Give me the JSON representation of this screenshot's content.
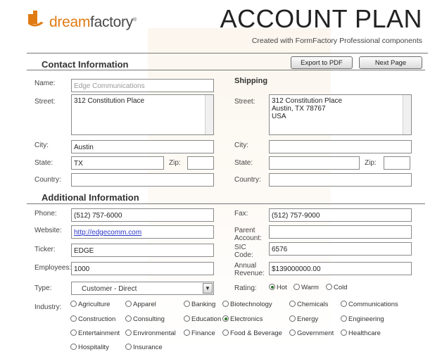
{
  "header": {
    "logo_text_accent": "dream",
    "logo_text_rest": "factory",
    "logo_tm": "®",
    "title": "ACCOUNT PLAN",
    "subtitle": "Created with FormFactory Professional components"
  },
  "toolbar": {
    "export_label": "Export to PDF",
    "next_label": "Next Page"
  },
  "contact": {
    "section_title": "Contact Information",
    "name_label": "Name:",
    "name_value": "Edge Communications",
    "street_label": "Street:",
    "street_value": "312 Constitution Place",
    "city_label": "City:",
    "city_value": "Austin",
    "state_label": "State:",
    "state_value": "TX",
    "zip_label": "Zip:",
    "zip_value": "",
    "country_label": "Country:",
    "country_value": ""
  },
  "shipping": {
    "section_title": "Shipping",
    "street_label": "Street:",
    "street_line1": "312 Constitution Place",
    "street_line2": "Austin, TX 78767",
    "street_line3": "USA",
    "city_label": "City:",
    "city_value": "",
    "state_label": "State:",
    "state_value": "",
    "zip_label": "Zip:",
    "zip_value": "",
    "country_label": "Country:",
    "country_value": ""
  },
  "additional": {
    "section_title": "Additional Information",
    "phone_label": "Phone:",
    "phone_value": "(512) 757-6000",
    "fax_label": "Fax:",
    "fax_value": "(512) 757-9000",
    "website_label": "Website:",
    "website_value": "http://edgecomm.com",
    "parent_label_1": "Parent",
    "parent_label_2": "Account:",
    "parent_value": "",
    "ticker_label": "Ticker:",
    "ticker_value": "EDGE",
    "sic_label_1": "SIC",
    "sic_label_2": "Code:",
    "sic_value": "6576",
    "employees_label": "Employees:",
    "employees_value": "1000",
    "revenue_label_1": "Annual",
    "revenue_label_2": "Revenue:",
    "revenue_value": "$139000000.00",
    "type_label": "Type:",
    "type_value": "Customer - Direct",
    "rating_label": "Rating:",
    "rating_options": [
      "Hot",
      "Warm",
      "Cold"
    ],
    "rating_selected": "Hot",
    "industry_label": "Industry:",
    "industry_options": [
      "Agriculture",
      "Apparel",
      "Banking",
      "Biotechnology",
      "Chemicals",
      "Communications",
      "Construction",
      "Consulting",
      "Education",
      "Electronics",
      "Energy",
      "Engineering",
      "Entertainment",
      "Environmental",
      "Finance",
      "Food & Beverage",
      "Government",
      "Healthcare",
      "Hospitality",
      "Insurance"
    ],
    "industry_selected": "Electronics"
  },
  "colors": {
    "accent": "#e07b14",
    "link": "#2a37c9",
    "radio_selected": "#2d7a2d"
  }
}
